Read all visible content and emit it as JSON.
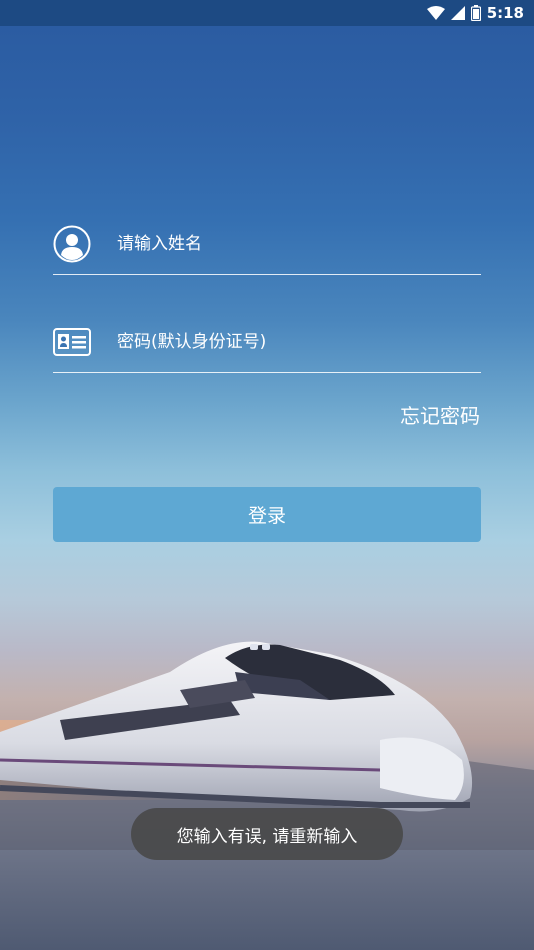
{
  "status_bar": {
    "time": "5:18",
    "icons": [
      "wifi-icon",
      "signal-icon",
      "battery-icon"
    ]
  },
  "login_form": {
    "name_placeholder": "请输入姓名",
    "password_placeholder": "密码(默认身份证号)",
    "forgot_password_label": "忘记密码",
    "login_button_label": "登录"
  },
  "toast": {
    "message": "您输入有误, 请重新输入"
  },
  "colors": {
    "status_bar": "#1d4a83",
    "login_button": "#5ea8d3",
    "text": "#ffffff"
  }
}
